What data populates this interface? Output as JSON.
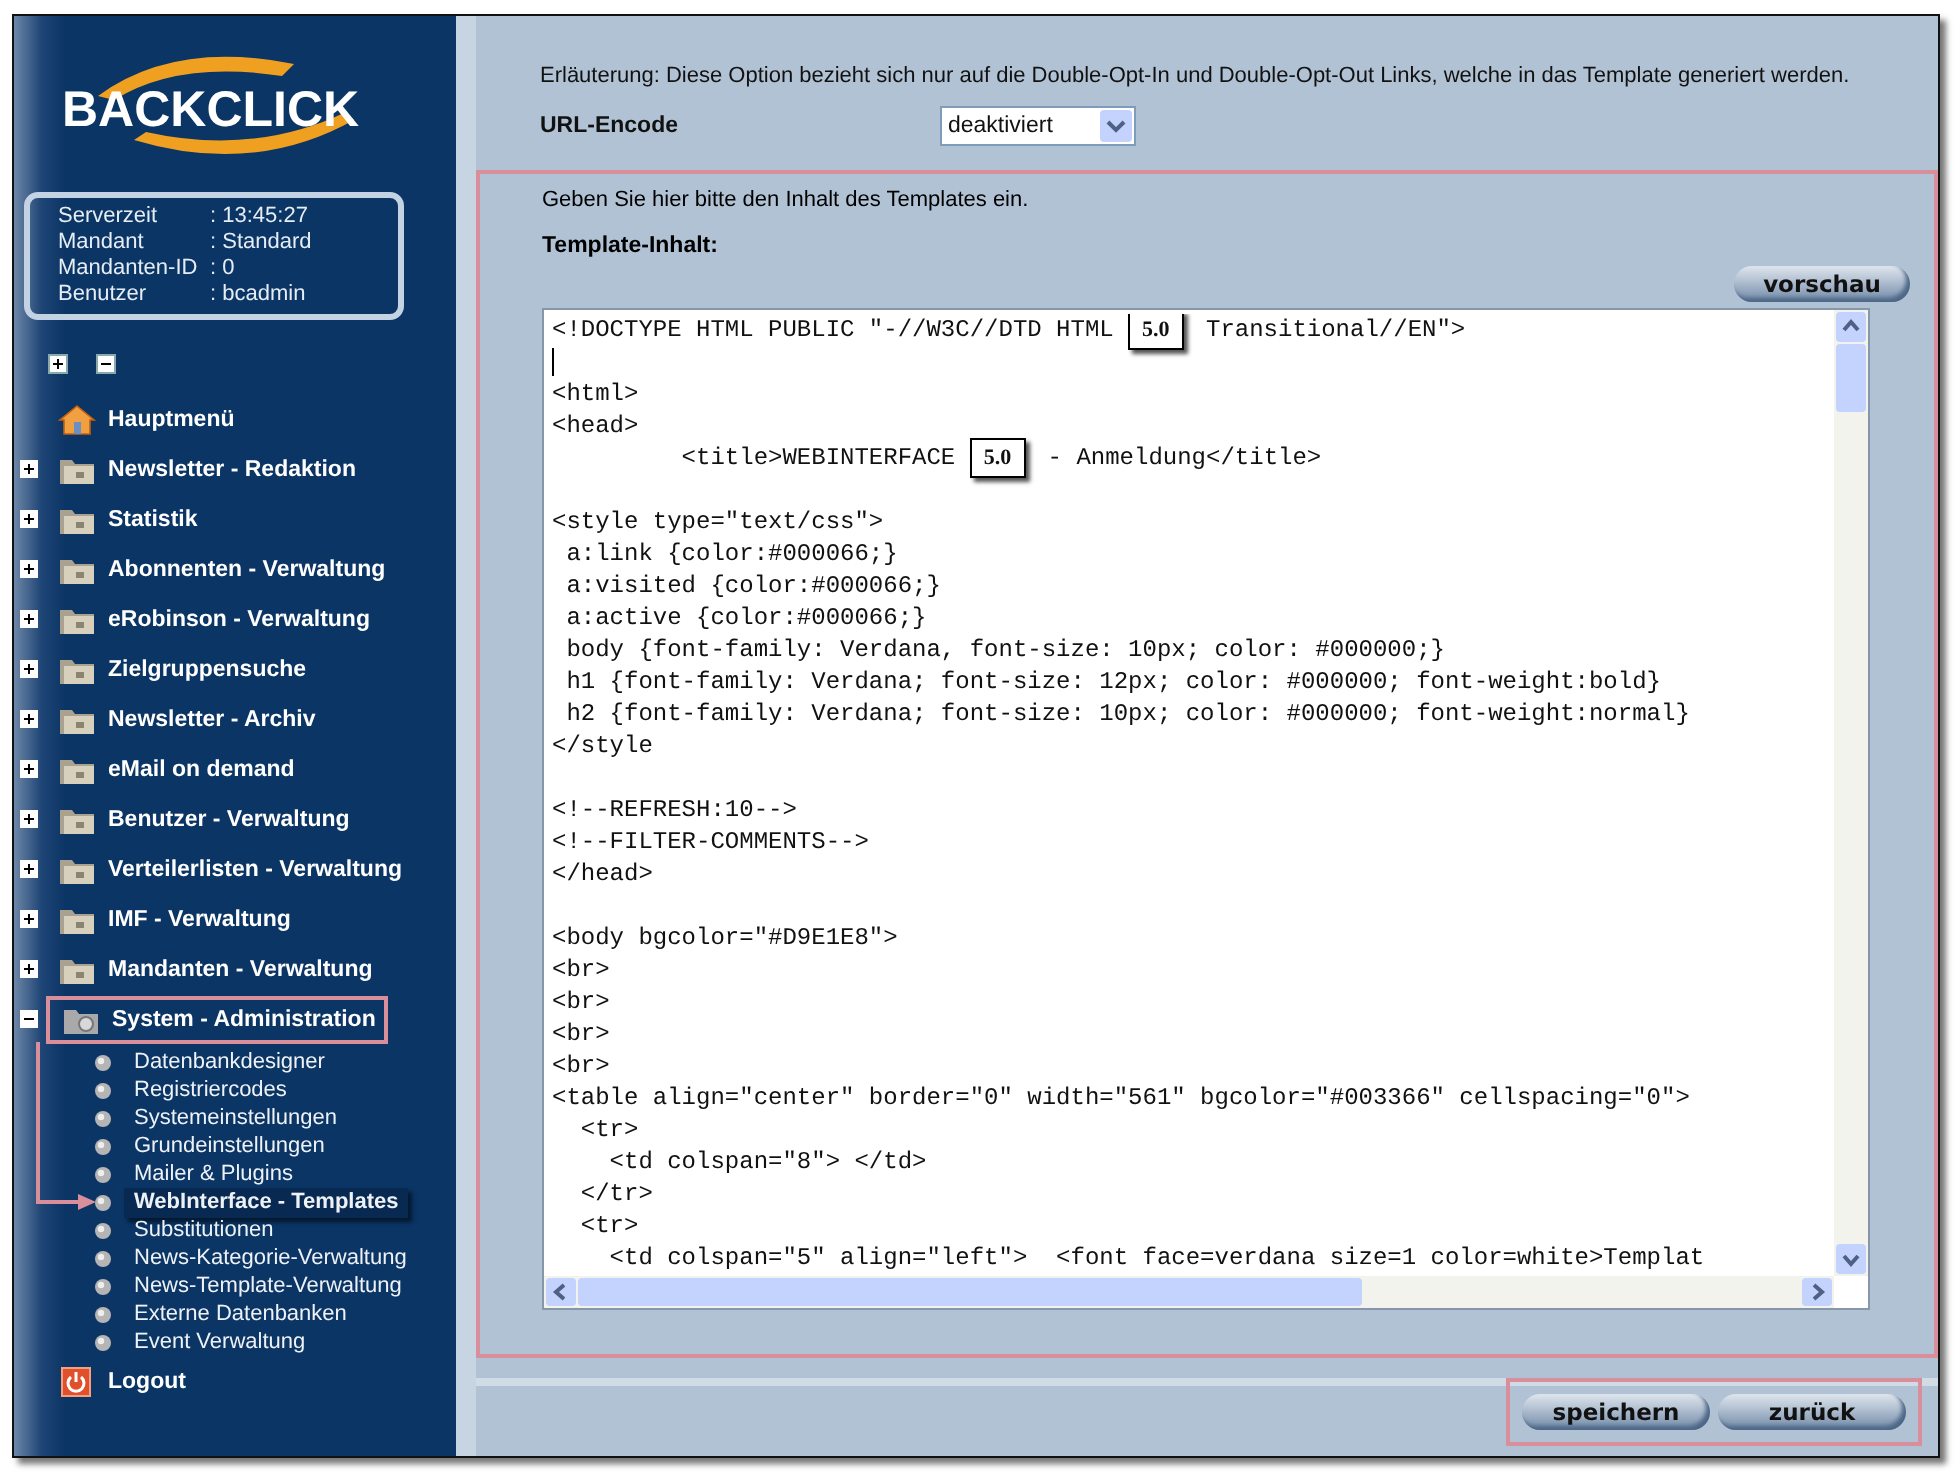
{
  "sidebar": {
    "logo": "BACKCLICK",
    "info": [
      {
        "label": "Serverzeit",
        "value": ": 13:45:27"
      },
      {
        "label": "Mandant",
        "value": ": Standard"
      },
      {
        "label": "Mandanten-ID",
        "value": ": 0"
      },
      {
        "label": "Benutzer",
        "value": ": bcadmin"
      }
    ],
    "menu": [
      {
        "kind": "home",
        "label": "Hauptmenü",
        "highlighted": false
      },
      {
        "kind": "folder",
        "label": "Newsletter - Redaktion",
        "expanded": false,
        "highlighted": false
      },
      {
        "kind": "folder",
        "label": "Statistik",
        "expanded": false,
        "highlighted": false
      },
      {
        "kind": "folder",
        "label": "Abonnenten - Verwaltung",
        "expanded": false,
        "highlighted": false
      },
      {
        "kind": "folder",
        "label": "eRobinson - Verwaltung",
        "expanded": false,
        "highlighted": false
      },
      {
        "kind": "folder",
        "label": "Zielgruppensuche",
        "expanded": false,
        "highlighted": false
      },
      {
        "kind": "folder",
        "label": "Newsletter - Archiv",
        "expanded": false,
        "highlighted": false
      },
      {
        "kind": "folder",
        "label": "eMail on demand",
        "expanded": false,
        "highlighted": false
      },
      {
        "kind": "folder",
        "label": "Benutzer - Verwaltung",
        "expanded": false,
        "highlighted": false
      },
      {
        "kind": "folder",
        "label": "Verteilerlisten - Verwaltung",
        "expanded": false,
        "highlighted": false
      },
      {
        "kind": "folder",
        "label": "IMF - Verwaltung",
        "expanded": false,
        "highlighted": false
      },
      {
        "kind": "folder",
        "label": "Mandanten - Verwaltung",
        "expanded": false,
        "highlighted": false
      },
      {
        "kind": "system",
        "label": "System - Administration",
        "expanded": true,
        "highlighted": true,
        "children": [
          {
            "label": "Datenbankdesigner",
            "selected": false
          },
          {
            "label": "Registriercodes",
            "selected": false
          },
          {
            "label": "Systemeinstellungen",
            "selected": false
          },
          {
            "label": "Grundeinstellungen",
            "selected": false
          },
          {
            "label": "Mailer & Plugins",
            "selected": false
          },
          {
            "label": "WebInterface - Templates",
            "selected": true
          },
          {
            "label": "Substitutionen",
            "selected": false
          },
          {
            "label": "News-Kategorie-Verwaltung",
            "selected": false
          },
          {
            "label": "News-Template-Verwaltung",
            "selected": false
          },
          {
            "label": "Externe Datenbanken",
            "selected": false
          },
          {
            "label": "Event Verwaltung",
            "selected": false
          }
        ]
      },
      {
        "kind": "logout",
        "label": "Logout",
        "highlighted": false
      }
    ]
  },
  "main": {
    "note": "Erläuterung: Diese Option bezieht sich nur auf die Double-Opt-In und Double-Opt-Out Links, welche in das Template generiert werden.",
    "url_encode": {
      "label": "URL-Encode",
      "value": "deaktiviert"
    },
    "template": {
      "highlighted": true,
      "hint": "Geben Sie hier bitte den Inhalt des Templates ein.",
      "label": "Template-Inhalt:",
      "preview_button": "vorschau",
      "lines": [
        {
          "kind": "mixed",
          "parts": [
            {
              "kind": "code",
              "text": "<!DOCTYPE HTML PUBLIC \"-//W3C//DTD HTML "
            },
            {
              "kind": "badge",
              "text": "5.0"
            },
            {
              "kind": "code",
              "text": " Transitional//EN\">"
            }
          ]
        },
        {
          "kind": "cursor"
        },
        {
          "kind": "code",
          "text": "<html>"
        },
        {
          "kind": "code",
          "text": "<head>"
        },
        {
          "kind": "mixed",
          "parts": [
            {
              "kind": "code",
              "text": "         <title>WEBINTERFACE "
            },
            {
              "kind": "badge",
              "text": "5.0"
            },
            {
              "kind": "code",
              "text": " - Anmeldung</title>"
            }
          ]
        },
        {
          "kind": "blank"
        },
        {
          "kind": "code",
          "text": "<style type=\"text/css\">"
        },
        {
          "kind": "code",
          "text": " a:link {color:#000066;}"
        },
        {
          "kind": "code",
          "text": " a:visited {color:#000066;}"
        },
        {
          "kind": "code",
          "text": " a:active {color:#000066;}"
        },
        {
          "kind": "code",
          "text": " body {font-family: Verdana, font-size: 10px; color: #000000;}"
        },
        {
          "kind": "code",
          "text": " h1 {font-family: Verdana; font-size: 12px; color: #000000; font-weight:bold}"
        },
        {
          "kind": "code",
          "text": " h2 {font-family: Verdana; font-size: 10px; color: #000000; font-weight:normal}"
        },
        {
          "kind": "code",
          "text": "</style"
        },
        {
          "kind": "blank"
        },
        {
          "kind": "code",
          "text": "<!--REFRESH:10-->"
        },
        {
          "kind": "code",
          "text": "<!--FILTER-COMMENTS-->"
        },
        {
          "kind": "code",
          "text": "</head>"
        },
        {
          "kind": "blank"
        },
        {
          "kind": "code",
          "text": "<body bgcolor=\"#D9E1E8\">"
        },
        {
          "kind": "code",
          "text": "<br>"
        },
        {
          "kind": "code",
          "text": "<br>"
        },
        {
          "kind": "code",
          "text": "<br>"
        },
        {
          "kind": "code",
          "text": "<br>"
        },
        {
          "kind": "code",
          "text": "<table align=\"center\" border=\"0\" width=\"561\" bgcolor=\"#003366\" cellspacing=\"0\">"
        },
        {
          "kind": "code",
          "text": "  <tr>"
        },
        {
          "kind": "code",
          "text": "    <td colspan=\"8\"> </td>"
        },
        {
          "kind": "code",
          "text": "  </tr>"
        },
        {
          "kind": "code",
          "text": "  <tr>"
        },
        {
          "kind": "code",
          "text": "    <td colspan=\"5\" align=\"left\">  <font face=verdana size=1 color=white>Templat"
        }
      ]
    },
    "buttons_highlighted": true,
    "buttons": [
      "speichern",
      "zurück"
    ]
  }
}
